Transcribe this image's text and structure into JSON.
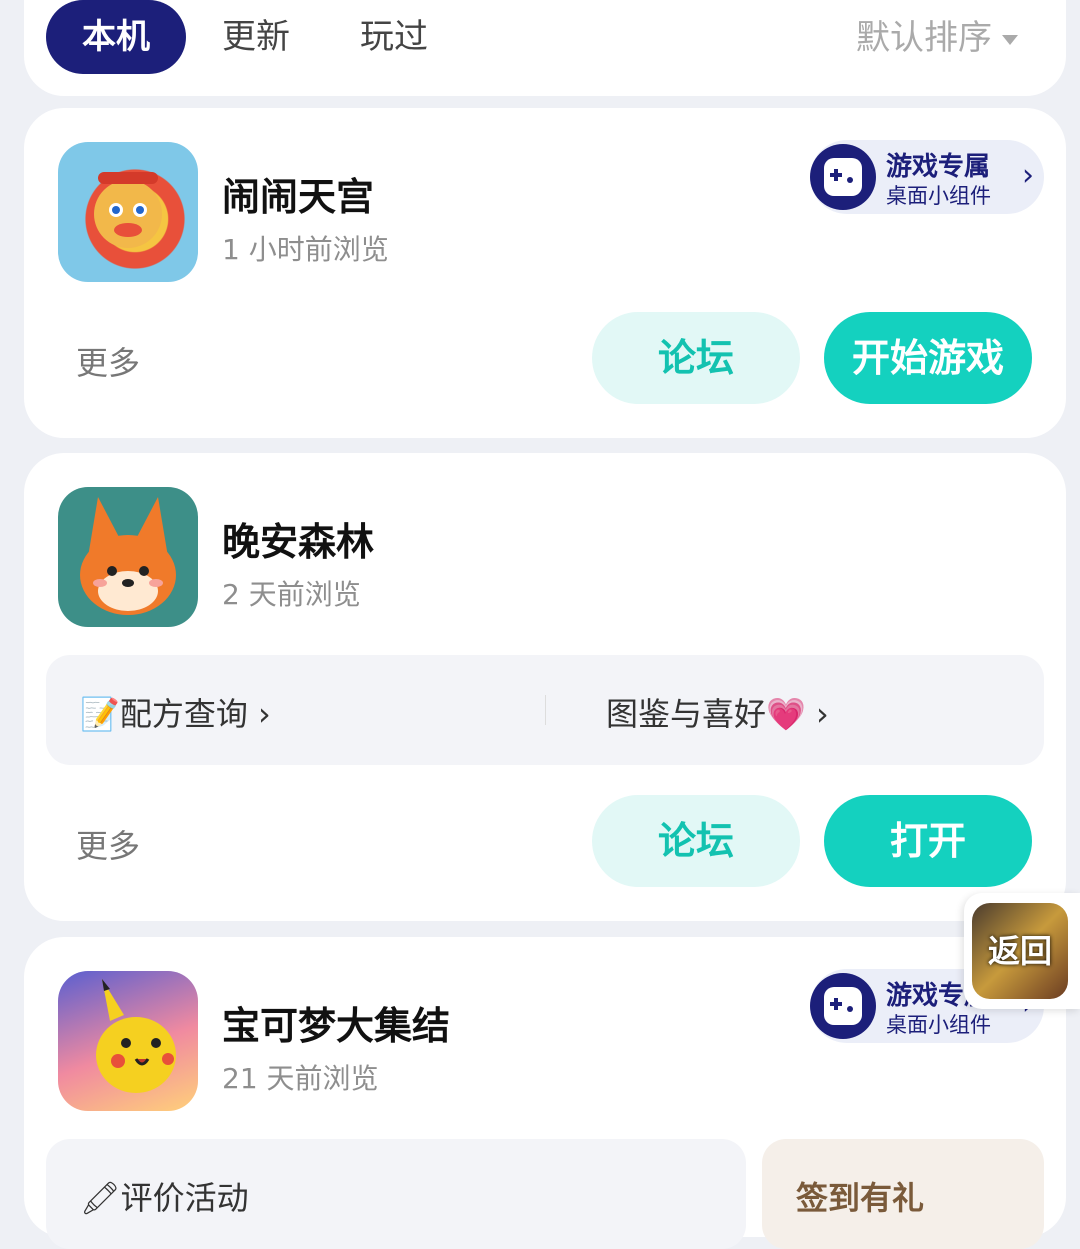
{
  "filter_bar": {
    "tabs": [
      {
        "label": "本机",
        "active": true
      },
      {
        "label": "更新",
        "active": false
      },
      {
        "label": "玩过",
        "active": false
      }
    ],
    "sort_label": "默认排序"
  },
  "games": [
    {
      "title": "闹闹天宫",
      "subtitle": "1 小时前浏览",
      "widget": {
        "title": "游戏专属",
        "subtitle": "桌面小组件"
      },
      "more_label": "更多",
      "forum_label": "论坛",
      "action_label": "开始游戏"
    },
    {
      "title": "晚安森林",
      "subtitle": "2 天前浏览",
      "quick_links": [
        "📝配方查询",
        "图鉴与喜好💗"
      ],
      "more_label": "更多",
      "forum_label": "论坛",
      "action_label": "打开"
    },
    {
      "title": "宝可梦大集结",
      "subtitle": "21 天前浏览",
      "widget": {
        "title": "游戏专属",
        "subtitle": "桌面小组件"
      },
      "quick_links": [
        "🖍评价活动",
        "签到有礼"
      ]
    }
  ],
  "float_back": {
    "label": "返回"
  },
  "colors": {
    "brand_navy": "#1c1f7a",
    "teal": "#14d1bf",
    "teal_light": "#e2f8f6",
    "background": "#eef0f5"
  }
}
